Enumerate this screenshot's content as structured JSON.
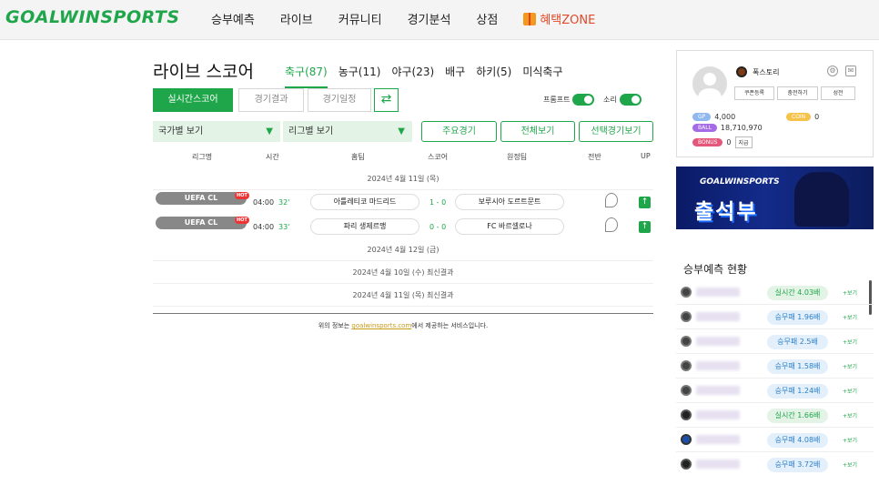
{
  "brand": {
    "logo": "GOALWINSPORTS"
  },
  "nav": [
    "승부예측",
    "라이브",
    "커뮤니티",
    "경기분석",
    "상점"
  ],
  "nav_zone": "혜택ZONE",
  "page_title": "라이브 스코어",
  "sport_tabs": [
    "축구(87)",
    "농구(11)",
    "야구(23)",
    "배구",
    "하키(5)",
    "미식축구"
  ],
  "mode_buttons": [
    "실시간스코어",
    "경기결과",
    "경기일정"
  ],
  "toggles": {
    "prompt": "프롬프트",
    "sound": "소리"
  },
  "filters": {
    "country": "국가별 보기",
    "league": "리그별 보기"
  },
  "filter_buttons": [
    "주요경기",
    "전체보기",
    "선택경기보기"
  ],
  "table_headers": [
    "리그명",
    "시간",
    "홈팀",
    "스코어",
    "원정팀",
    "전반",
    "UP"
  ],
  "dates": {
    "d1": "2024년 4월 11일 (목)",
    "d2": "2024년 4월 12일 (금)",
    "r1": "2024년 4월 10일 (수) 최신결과",
    "r2": "2024년 4월 11일 (목) 최신결과"
  },
  "matches": [
    {
      "league": "UEFA CL",
      "hot": "HOT",
      "time": "04:00",
      "minute": "32'",
      "home": "아틀레티코 마드리드",
      "score": "1 - 0",
      "away": "보루시아 도르트문트"
    },
    {
      "league": "UEFA CL",
      "hot": "HOT",
      "time": "04:00",
      "minute": "33'",
      "home": "파리 생제르맹",
      "score": "0 - 0",
      "away": "FC 바르셀로나"
    }
  ],
  "footer": {
    "prefix": "위의 정보는 ",
    "link": "goalwinsports.com",
    "suffix": "에서 제공하는 서비스입니다."
  },
  "profile": {
    "username": "폭스토리",
    "buttons": [
      "쿠폰등록",
      "충전하기",
      "성전"
    ],
    "gp_label": "GP",
    "gp_value": "4,000",
    "coin_label": "COIN",
    "coin_value": "0",
    "ball_label": "BALL",
    "ball_value": "18,710,970",
    "bonus_label": "BONUS",
    "bonus_value": "0",
    "charge": "지급"
  },
  "banner": {
    "line1": "GOALWINSPORTS",
    "line2": "출석부"
  },
  "prediction": {
    "title": "승부예측 현황",
    "more": "+보기",
    "rows": [
      {
        "badge": "실시간 4.03배",
        "kind": "live"
      },
      {
        "badge": "승무패 1.96배",
        "kind": "wdl"
      },
      {
        "badge": "승무패 2.5배",
        "kind": "wdl"
      },
      {
        "badge": "승무패 1.58배",
        "kind": "wdl"
      },
      {
        "badge": "승무패 1.24배",
        "kind": "wdl"
      },
      {
        "badge": "실시간 1.66배",
        "kind": "live"
      },
      {
        "badge": "승무패 4.08배",
        "kind": "wdl"
      },
      {
        "badge": "승무패 3.72배",
        "kind": "wdl"
      }
    ]
  },
  "colors": {
    "accent": "#1fa64a",
    "hot": "#e33333",
    "zone": "#e04a2a"
  }
}
